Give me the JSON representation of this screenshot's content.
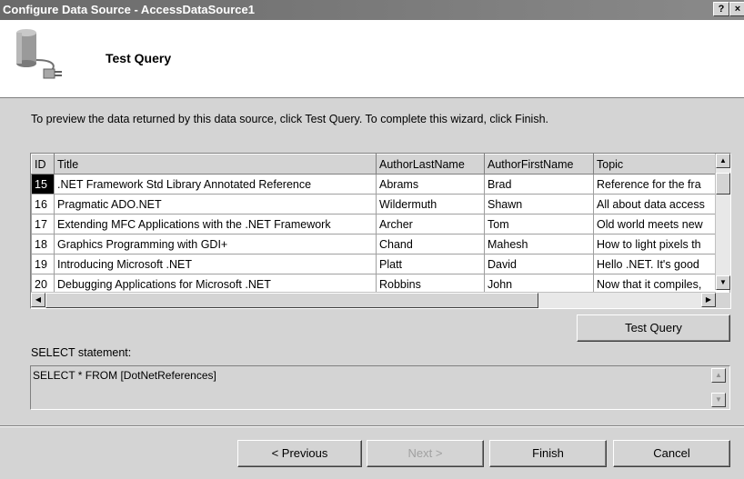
{
  "window": {
    "title": "Configure Data Source - AccessDataSource1",
    "help_label": "?",
    "close_label": "×"
  },
  "header": {
    "title": "Test Query",
    "icon": "database-icon"
  },
  "instructions": "To preview the data returned by this data source, click Test Query. To complete this wizard, click Finish.",
  "grid": {
    "columns": [
      "ID",
      "Title",
      "AuthorLastName",
      "AuthorFirstName",
      "Topic"
    ],
    "rows": [
      [
        "15",
        ".NET Framework Std Library Annotated Reference",
        "Abrams",
        "Brad",
        "Reference for the fra"
      ],
      [
        "16",
        "Pragmatic ADO.NET",
        "Wildermuth",
        "Shawn",
        "All about data access"
      ],
      [
        "17",
        "Extending MFC Applications with the .NET Framework",
        "Archer",
        "Tom",
        "Old world meets new"
      ],
      [
        "18",
        "Graphics Programming with GDI+",
        "Chand",
        "Mahesh",
        "How to light pixels th"
      ],
      [
        "19",
        "Introducing Microsoft .NET",
        "Platt",
        "David",
        "Hello .NET. It's good"
      ],
      [
        "20",
        "Debugging Applications for Microsoft .NET",
        "Robbins",
        "John",
        "Now that it compiles,"
      ]
    ],
    "selected_row": 0
  },
  "test_query_label": "Test Query",
  "select_statement": {
    "label": "SELECT statement:",
    "value": "SELECT * FROM [DotNetReferences]"
  },
  "footer": {
    "previous_label": "< Previous",
    "next_label": "Next >",
    "finish_label": "Finish",
    "cancel_label": "Cancel"
  }
}
